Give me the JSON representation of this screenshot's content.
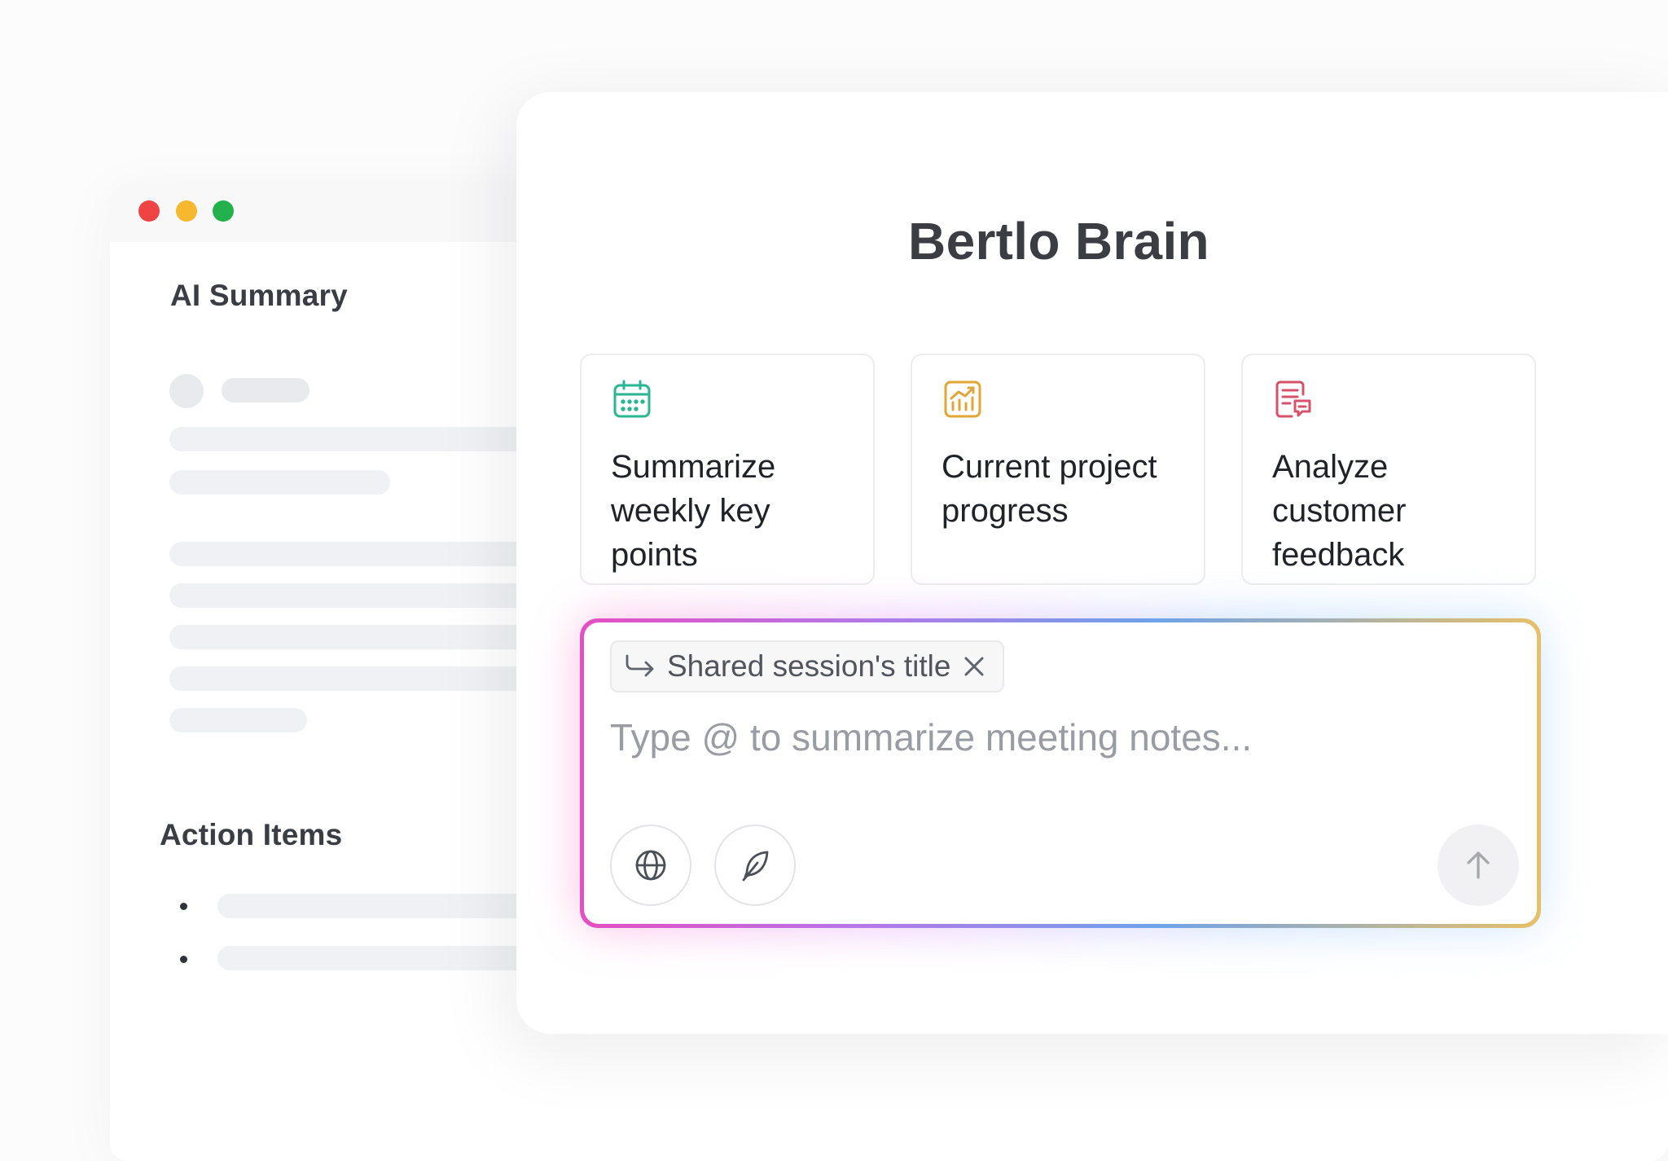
{
  "window": {
    "controls": [
      "close",
      "minimize",
      "maximize"
    ]
  },
  "background_doc": {
    "ai_summary_title": "AI Summary",
    "action_items_title": "Action Items"
  },
  "main": {
    "brand_title": "Bertlo Brain",
    "cards": [
      {
        "icon": "calendar-icon",
        "label": "Summarize weekly key points",
        "accent": "#2bb592"
      },
      {
        "icon": "chart-icon",
        "label": "Current project progress",
        "accent": "#e0a636"
      },
      {
        "icon": "document-feedback-icon",
        "label": "Analyze customer feedback",
        "accent": "#d4536a"
      }
    ],
    "composer": {
      "chip_label": "Shared session's title",
      "input_value": "",
      "placeholder": "Type @ to summarize meeting notes...",
      "tools": [
        "globe-icon",
        "feather-icon"
      ],
      "send": "arrow-up-icon"
    }
  },
  "colors": {
    "gradient": [
      "#e44fc2",
      "#b478e8",
      "#6fa3ea",
      "#e7bf6a"
    ],
    "dot_red": "#ef4444",
    "dot_yellow": "#f5b82e",
    "dot_green": "#22b14c"
  }
}
